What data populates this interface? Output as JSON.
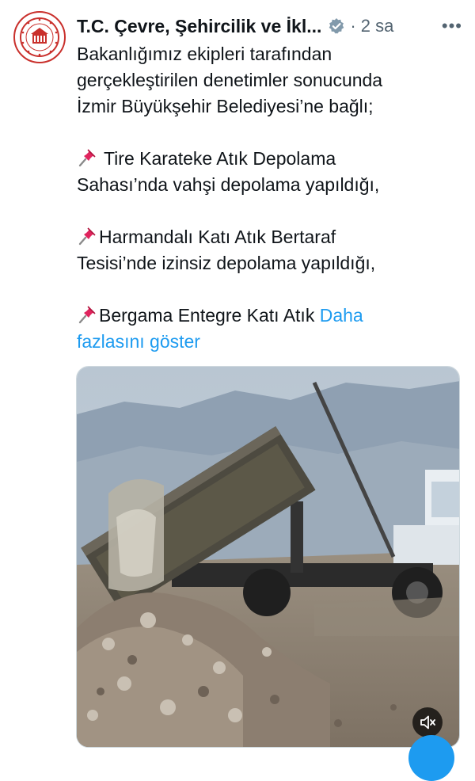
{
  "post": {
    "author": "T.C. Çevre, Şehircilik ve İkl...",
    "separator": "·",
    "time": "2 sa",
    "more": "•••",
    "text": {
      "line1": "Bakanlığımız ekipleri tarafından",
      "line2": "gerçekleştirilen denetimler sonucunda",
      "line3": "İzmir Büyükşehir Belediyesi’ne bağlı;",
      "item1_line1": "Tire Karateke Atık Depolama",
      "item1_line2": "Sahası’nda vahşi depolama yapıldığı,",
      "item2_line1": "Harmandalı Katı Atık Bertaraf",
      "item2_line2": "Tesisi’nde izinsiz depolama yapıldığı,",
      "item3_line1": "Bergama Entegre Katı Atık",
      "show_more_part1": "Daha",
      "show_more_part2": "fazlasını göster"
    }
  },
  "media": {
    "type": "video",
    "mute_icon": "volume-muted-icon"
  },
  "icons": {
    "verified": "verified-badge-icon",
    "pin": "pushpin-icon",
    "compose": "compose-fab"
  },
  "colors": {
    "text": "#0f1419",
    "secondary": "#536471",
    "link": "#1d9bf0",
    "fab": "#1d9bf0"
  }
}
